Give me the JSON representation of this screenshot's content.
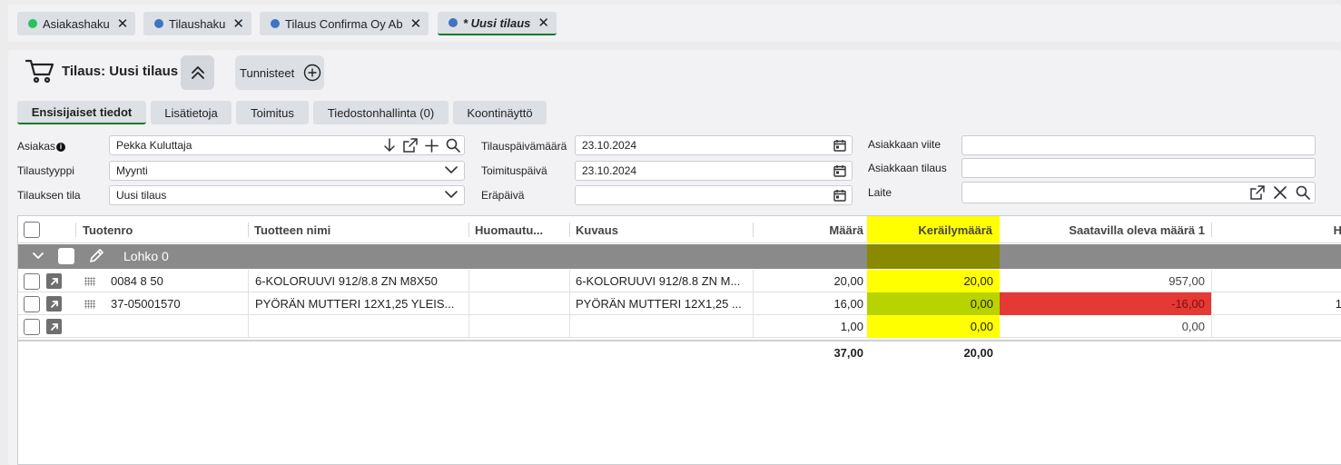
{
  "topTabs": [
    {
      "label": "Asiakashaku",
      "dot": "#22c55e"
    },
    {
      "label": "Tilaushaku",
      "dot": "#3d74c4"
    },
    {
      "label": "Tilaus Confirma Oy Ab",
      "dot": "#3d74c4"
    },
    {
      "label": "* Uusi tilaus",
      "dot": "#3d74c4",
      "active": true
    }
  ],
  "header": {
    "title": "Tilaus: Uusi tilaus",
    "tags_label": "Tunnisteet"
  },
  "subTabs": [
    "Ensisijaiset tiedot",
    "Lisätietoja",
    "Toimitus",
    "Tiedostonhallinta (0)",
    "Koontinäyttö"
  ],
  "form": {
    "asiakas": {
      "label": "Asiakas",
      "value": "Pekka Kuluttaja"
    },
    "tilaustyyppi": {
      "label": "Tilaustyyppi",
      "value": "Myynti"
    },
    "tilauksen_tila": {
      "label": "Tilauksen tila",
      "value": "Uusi tilaus"
    },
    "tilauspaivamaara": {
      "label": "Tilauspäivämäärä",
      "value": "23.10.2024"
    },
    "toimituspaiva": {
      "label": "Toimituspäivä",
      "value": "23.10.2024"
    },
    "erapaiva": {
      "label": "Eräpäivä",
      "value": ""
    },
    "asiakkaan_viite": {
      "label": "Asiakkaan viite",
      "value": ""
    },
    "asiakkaan_tilaus": {
      "label": "Asiakkaan tilaus",
      "value": ""
    },
    "laite": {
      "label": "Laite",
      "value": ""
    }
  },
  "grid": {
    "columns": {
      "tuotenro": "Tuotenro",
      "nimi": "Tuotteen nimi",
      "huom": "Huomautu...",
      "kuvaus": "Kuvaus",
      "maara": "Määrä",
      "kerailymaara": "Keräilymäärä",
      "saatavilla": "Saatavilla oleva määrä 1",
      "extra": "H"
    },
    "group_label": "Lohko 0",
    "rows": [
      {
        "tuotenro": "0084 8 50",
        "nimi": "6-KOLORUUVI 912/8.8 ZN M8X50",
        "huom": "",
        "kuvaus": "6-KOLORUUVI 912/8.8 ZN M...",
        "maara": "20,00",
        "kerailymaara": "20,00",
        "saatavilla": "957,00",
        "extra": ""
      },
      {
        "tuotenro": "37-05001570",
        "nimi": "PYÖRÄN MUTTERI 12X1,25 YLEIS...",
        "huom": "",
        "kuvaus": "PYÖRÄN MUTTERI 12X1,25 ...",
        "maara": "16,00",
        "kerailymaara": "0,00",
        "saatavilla": "-16,00",
        "extra": "1"
      },
      {
        "tuotenro": "",
        "nimi": "",
        "huom": "",
        "kuvaus": "",
        "maara": "1,00",
        "kerailymaara": "0,00",
        "saatavilla": "0,00",
        "extra": ""
      }
    ],
    "totals": {
      "maara": "37,00",
      "kerailymaara": "20,00"
    }
  },
  "colors": {
    "highlight": "#ffff00",
    "highlight_dark": "#8a8a00",
    "highlight_partial": "#b8d400",
    "negative": "#e53935",
    "active_tab_underline": "#0b7a27"
  }
}
